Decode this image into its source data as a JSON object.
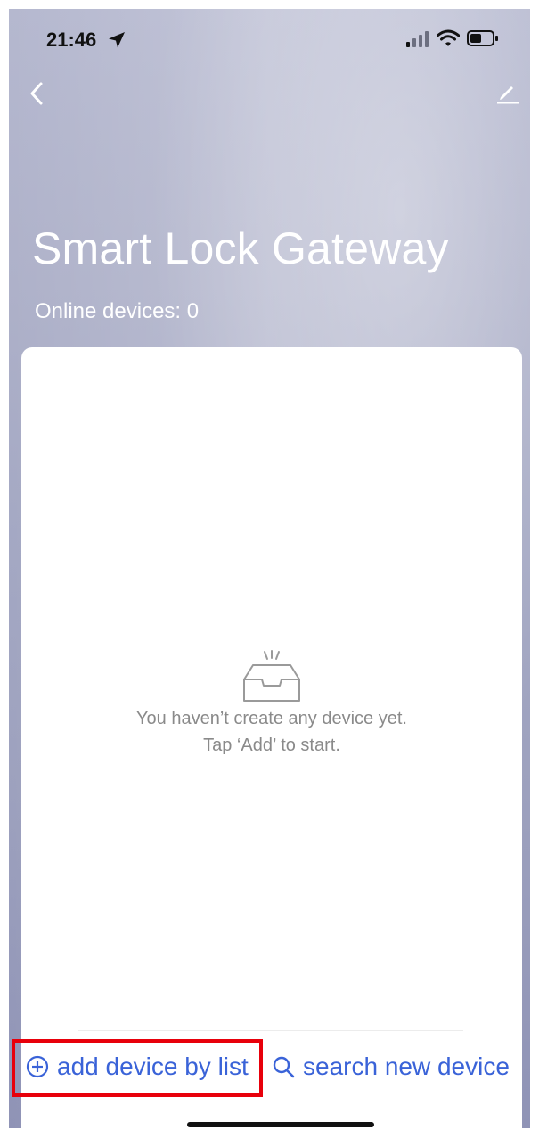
{
  "status_bar": {
    "time": "21:46"
  },
  "header": {
    "title": "Smart Lock Gateway",
    "online_devices": "Online devices: 0"
  },
  "empty_state": {
    "line1": "You haven’t create any device yet.",
    "line2": "Tap ‘Add’ to start."
  },
  "actions": {
    "add_by_list": "add device by list",
    "search_new": "search new device"
  },
  "colors": {
    "accent": "#3a63d8",
    "highlight": "#e8000b"
  },
  "icons": [
    "location-arrow-icon",
    "signal-icon",
    "wifi-icon",
    "battery-icon",
    "back-chevron-icon",
    "edit-pencil-icon",
    "empty-inbox-icon",
    "add-circle-icon",
    "search-icon"
  ]
}
